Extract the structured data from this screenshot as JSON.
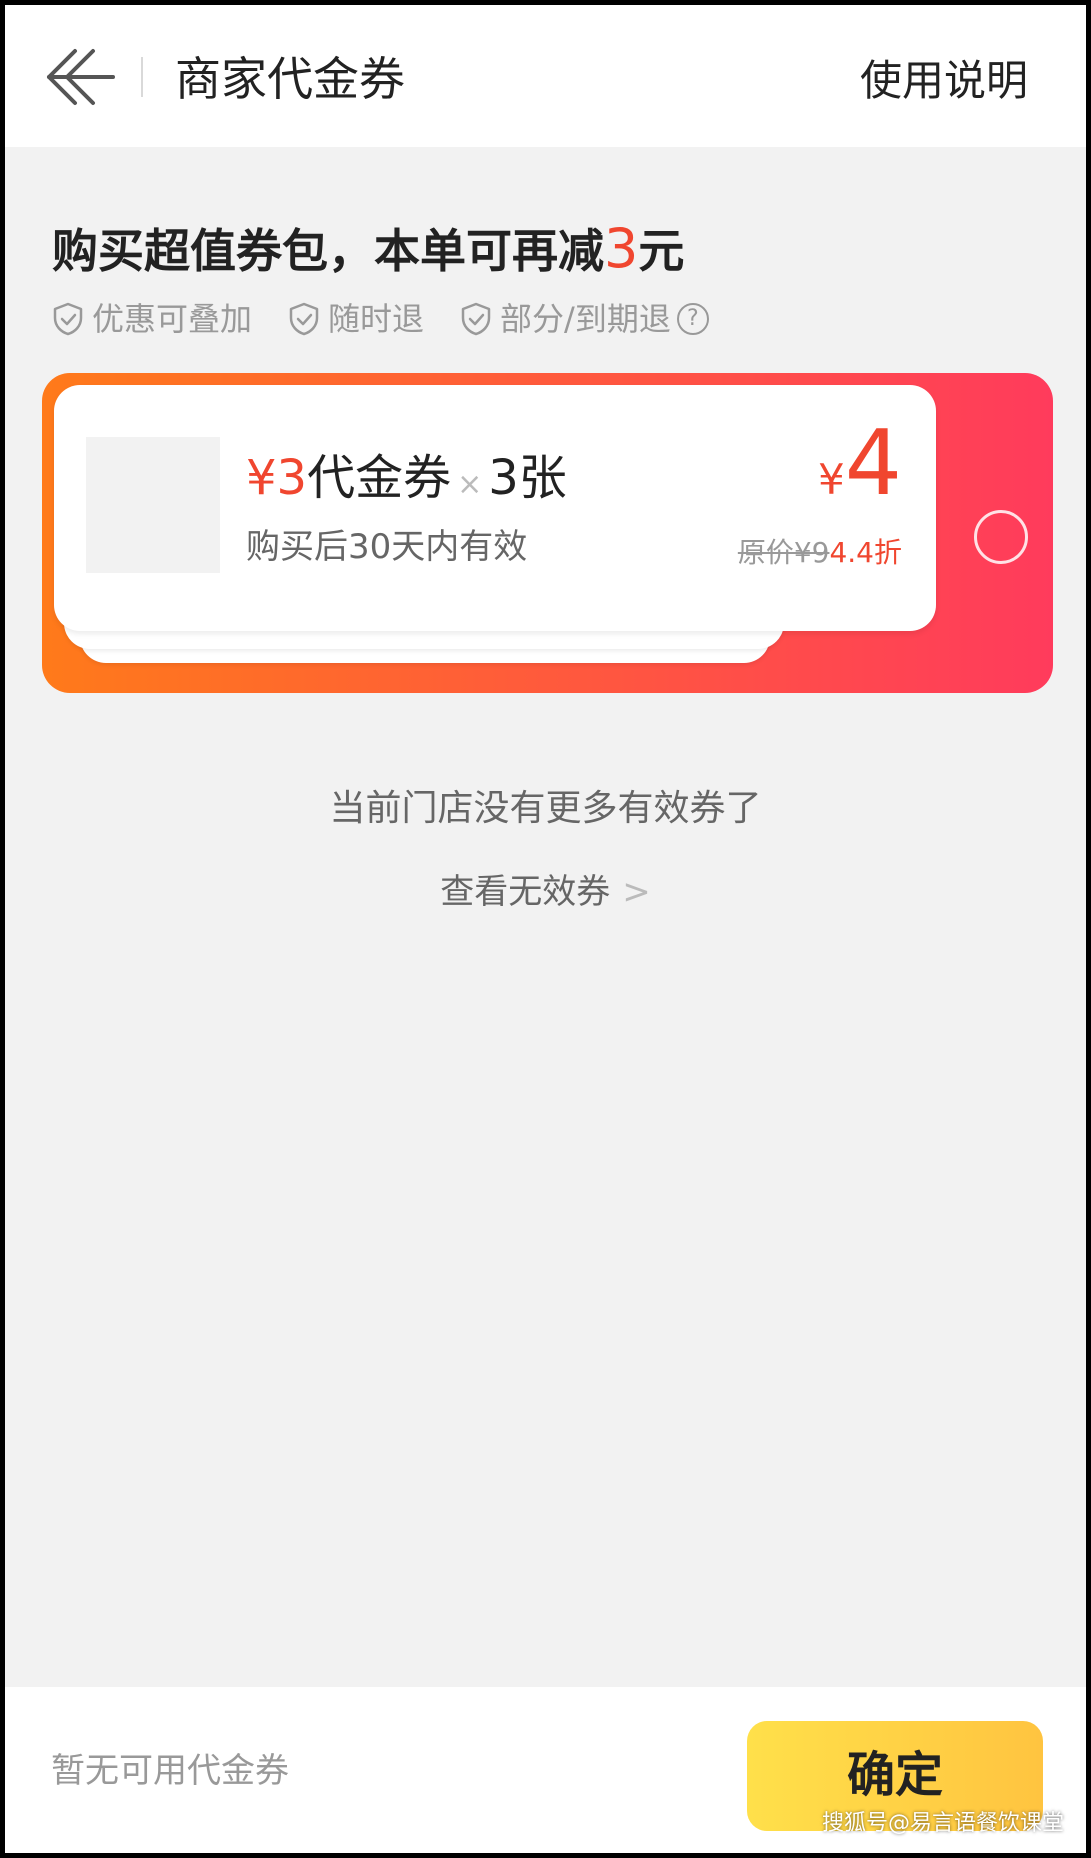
{
  "header": {
    "title": "商家代金券",
    "help_label": "使用说明"
  },
  "promo": {
    "title_prefix": "购买超值券包，本单可再减",
    "title_amount": "3",
    "title_suffix": "元",
    "tags": [
      "优惠可叠加",
      "随时退",
      "部分/到期退"
    ],
    "help_glyph": "?"
  },
  "coupon": {
    "currency": "¥",
    "amount": "3",
    "name": "代金券",
    "times": "×",
    "count": "3张",
    "validity": "购买后30天内有效",
    "price": "4",
    "orig_label": "原价¥9",
    "discount": "4.4折",
    "selected": false
  },
  "empty_state": {
    "no_more": "当前门店没有更多有效券了",
    "view_invalid": "查看无效券",
    "chevron": ">"
  },
  "footer": {
    "note": "暂无可用代金券",
    "confirm_label": "确定"
  },
  "watermark": "搜狐号@易言语餐饮课堂",
  "colors": {
    "accent_red": "#f0462f",
    "card_gradient_start": "#ff7a1a",
    "card_gradient_end": "#ff3b5c",
    "confirm_yellow": "#ffd845",
    "background": "#f2f2f2"
  },
  "icons": {
    "back": "arrow-left-icon",
    "tag": "shield-check-icon",
    "help": "question-circle-icon"
  }
}
